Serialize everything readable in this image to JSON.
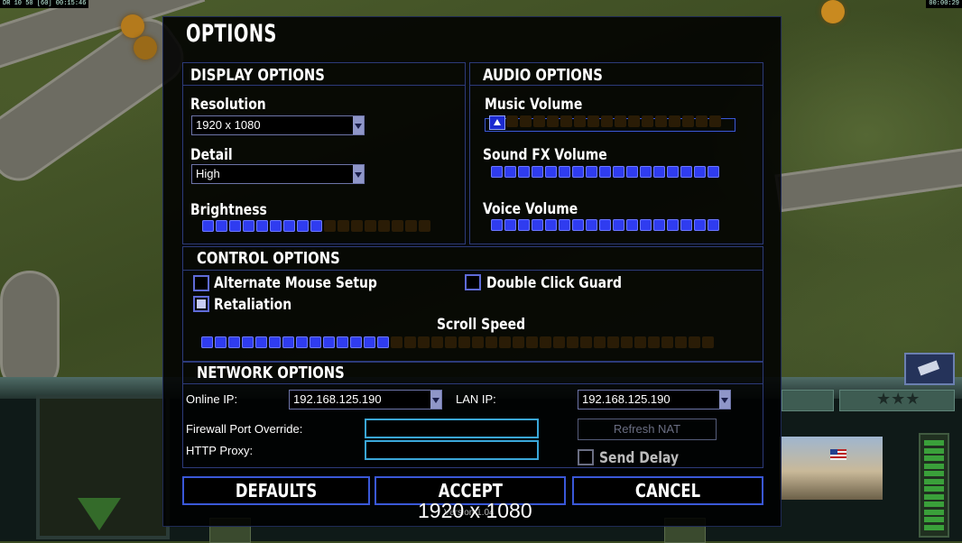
{
  "hud": {
    "top_left_status": "DR 10 50 [60] 00:15:46",
    "top_right_time": "00:00:29"
  },
  "options": {
    "title": "OPTIONS",
    "display": {
      "heading": "DISPLAY OPTIONS",
      "resolution_label": "Resolution",
      "resolution_value": "1920 x 1080",
      "detail_label": "Detail",
      "detail_value": "High",
      "brightness_label": "Brightness",
      "brightness_level": 0.52
    },
    "audio": {
      "heading": "AUDIO OPTIONS",
      "music_label": "Music Volume",
      "music_level": 0.0,
      "sfx_label": "Sound FX Volume",
      "sfx_level": 1.0,
      "voice_label": "Voice Volume",
      "voice_level": 1.0
    },
    "control": {
      "heading": "CONTROL OPTIONS",
      "alt_mouse_label": "Alternate Mouse Setup",
      "alt_mouse_checked": false,
      "double_click_label": "Double Click Guard",
      "double_click_checked": false,
      "retaliation_label": "Retaliation",
      "retaliation_checked": true,
      "scroll_speed_label": "Scroll Speed",
      "scroll_speed_level": 0.37
    },
    "network": {
      "heading": "NETWORK OPTIONS",
      "online_ip_label": "Online IP:",
      "online_ip_value": "192.168.125.190",
      "lan_ip_label": "LAN IP:",
      "lan_ip_value": "192.168.125.190",
      "firewall_label": "Firewall Port Override:",
      "firewall_value": "",
      "http_proxy_label": "HTTP Proxy:",
      "http_proxy_value": "",
      "refresh_nat_label": "Refresh NAT",
      "send_delay_label": "Send Delay",
      "send_delay_checked": false
    },
    "buttons": {
      "defaults": "DEFAULTS",
      "accept": "ACCEPT",
      "cancel": "CANCEL"
    },
    "version_text": "Version 1.04",
    "resolution_overlay": "1920 x 1080"
  },
  "colors": {
    "slider_on": "#2f3cf0",
    "slider_off": "#2a1c06",
    "border_blue": "#3a58d8"
  }
}
